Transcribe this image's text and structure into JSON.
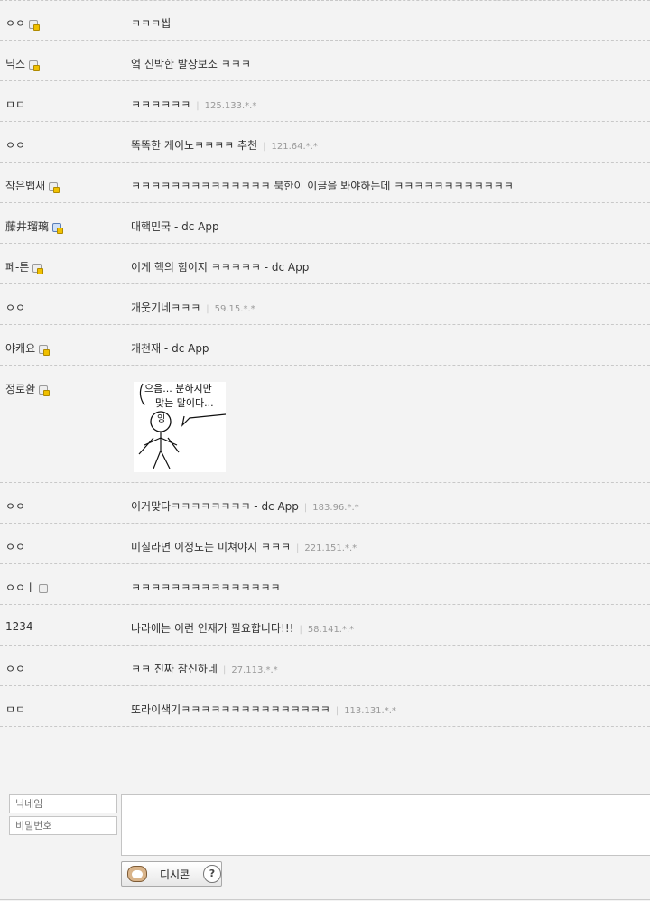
{
  "comments": [
    {
      "nick": "ㅇㅇ",
      "icon": "fixed",
      "text": "ㅋㅋㅋ씹",
      "ip": ""
    },
    {
      "nick": "닉스",
      "icon": "fixed",
      "text": "엌 신박한 발상보소 ㅋㅋㅋ",
      "ip": ""
    },
    {
      "nick": "ㅁㅁ",
      "icon": "",
      "text": "ㅋㅋㅋㅋㅋㅋ",
      "ip": "125.133.*.*"
    },
    {
      "nick": "ㅇㅇ",
      "icon": "",
      "text": "똑똑한 게이노ㅋㅋㅋㅋ 추천",
      "ip": "121.64.*.*"
    },
    {
      "nick": "작은뱁새",
      "icon": "fixed",
      "text": "ㅋㅋㅋㅋㅋㅋㅋㅋㅋㅋㅋㅋㅋㅋ 북한이 이글을 봐야하는데 ㅋㅋㅋㅋㅋㅋㅋㅋㅋㅋㅋㅋ",
      "ip": ""
    },
    {
      "nick": "藤井瑠璃",
      "icon": "blue",
      "text": "대핵민국 - dc App",
      "ip": ""
    },
    {
      "nick": "페-튼",
      "icon": "fixed",
      "text": "이게 핵의 힘이지 ㅋㅋㅋㅋㅋ - dc App",
      "ip": ""
    },
    {
      "nick": "ㅇㅇ",
      "icon": "",
      "text": "개웃기네ㅋㅋㅋ",
      "ip": "59.15.*.*"
    },
    {
      "nick": "야캐요",
      "icon": "fixed",
      "text": "개천재 - dc App",
      "ip": ""
    },
    {
      "nick": "정로환",
      "icon": "fixed",
      "text": "",
      "ip": ""
    },
    {
      "nick": "ㅇㅇ",
      "icon": "",
      "text": "이거맞다ㅋㅋㅋㅋㅋㅋㅋㅋ - dc App",
      "ip": "183.96.*.*"
    },
    {
      "nick": "ㅇㅇ",
      "icon": "",
      "text": "미칠라면 이정도는 미쳐야지 ㅋㅋㅋ",
      "ip": "221.151.*.*"
    },
    {
      "nick": "ㅇㅇㅣ",
      "icon": "plain",
      "text": "ㅋㅋㅋㅋㅋㅋㅋㅋㅋㅋㅋㅋㅋㅋㅋ",
      "ip": ""
    },
    {
      "nick": "1234",
      "icon": "",
      "text": "나라에는 이런 인재가 필요합니다!!!",
      "ip": "58.141.*.*"
    },
    {
      "nick": "ㅇㅇ",
      "icon": "",
      "text": "ㅋㅋ 진짜 참신하네",
      "ip": "27.113.*.*"
    },
    {
      "nick": "ㅁㅁ",
      "icon": "",
      "text": "또라이색기ㅋㅋㅋㅋㅋㅋㅋㅋㅋㅋㅋㅋㅋㅋㅋ",
      "ip": "113.131.*.*"
    }
  ],
  "dccon_image": {
    "line1": "으음... 분하지만",
    "line2": "맞는 말이다...",
    "face": "잉"
  },
  "form": {
    "nickname_placeholder": "닉네임",
    "password_placeholder": "비밀번호",
    "dccon_label": "디시콘",
    "help_label": "?"
  }
}
